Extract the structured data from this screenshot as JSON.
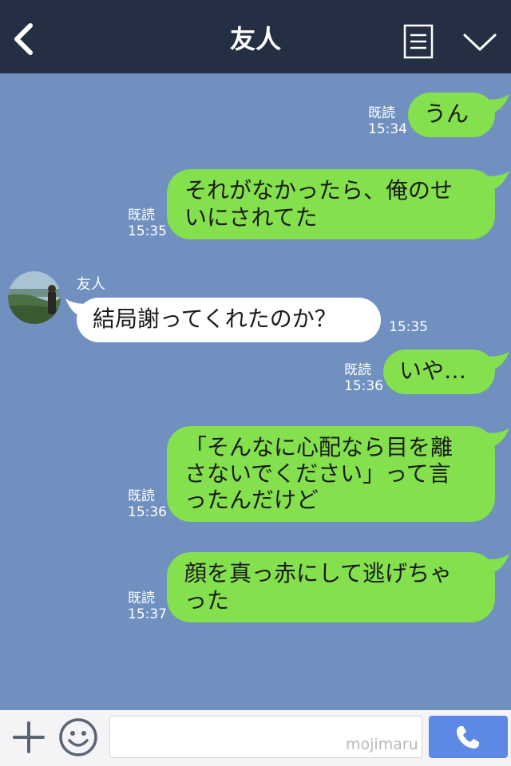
{
  "header": {
    "title": "友人"
  },
  "messages": [
    {
      "text": "うん",
      "read": "既読",
      "time": "15:34"
    },
    {
      "text": "それがなかったら、俺のせいにされてた",
      "line1": "それがなかったら、俺のせ",
      "line2": "いにされてた",
      "read": "既読",
      "time": "15:35"
    },
    {
      "sender": "友人",
      "text": "結局謝ってくれたのか？",
      "time": "15:35"
    },
    {
      "text": "いや…",
      "read": "既読",
      "time": "15:36"
    },
    {
      "text": "「そんなに心配なら目を離さないでください」って言ったんだけど",
      "line1": "「そんなに心配なら目を離",
      "line2": "さないでください」って言",
      "line3": "ったんだけど",
      "read": "既読",
      "time": "15:36"
    },
    {
      "text": "顔を真っ赤にして逃げちゃった",
      "line1": "顔を真っ赤にして逃げちゃ",
      "line2": "った",
      "read": "既読",
      "time": "15:37"
    }
  ],
  "input": {
    "value": "",
    "watermark": "mojimaru"
  },
  "colors": {
    "header_bg": "#242f43",
    "chat_bg": "#7090c0",
    "outgoing_bubble": "#84e04c",
    "incoming_bubble": "#ffffff",
    "call_button": "#5e88e6"
  },
  "icons": [
    "back-icon",
    "menu-icon",
    "chevron-down-icon",
    "plus-icon",
    "emoji-icon",
    "phone-icon"
  ]
}
